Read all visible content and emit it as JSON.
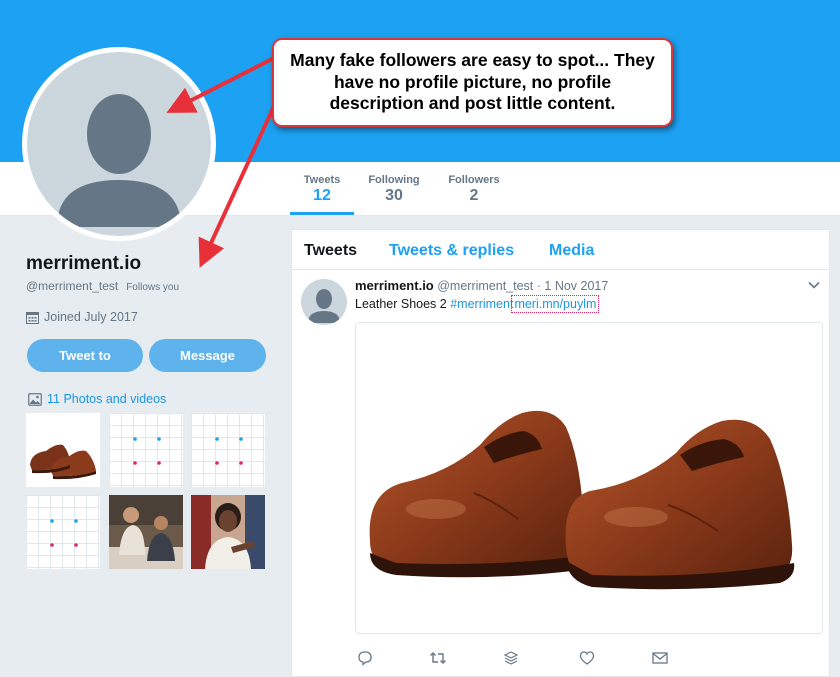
{
  "profile": {
    "name": "merriment.io",
    "handle": "@merriment_test",
    "follows_you": "Follows you",
    "joined": "Joined July 2017",
    "tweet_to_label": "Tweet to",
    "message_label": "Message",
    "photos_videos": "11 Photos and videos"
  },
  "stats": [
    {
      "label": "Tweets",
      "value": "12"
    },
    {
      "label": "Following",
      "value": "30"
    },
    {
      "label": "Followers",
      "value": "2"
    }
  ],
  "tabs": [
    "Tweets",
    "Tweets & replies",
    "Media"
  ],
  "tweet": {
    "author": "merriment.io",
    "handle_date": "@merriment_test · 1 Nov 2017",
    "text": "Leather Shoes 2 ",
    "hashtag": "#merriment",
    "link": "meri.mn/puylm"
  },
  "callout": {
    "text": "Many fake followers are easy to spot... They have no profile picture, no profile description and post little content."
  },
  "colors": {
    "accent": "#1da1f2",
    "link": "#1b95e0",
    "button": "#5eb3ec",
    "annotation_red": "#e8303a"
  },
  "icons": [
    "calendar-icon",
    "photo-icon",
    "chevron-down-icon",
    "reply-icon",
    "retweet-icon",
    "stack-icon",
    "like-icon",
    "message-icon"
  ]
}
